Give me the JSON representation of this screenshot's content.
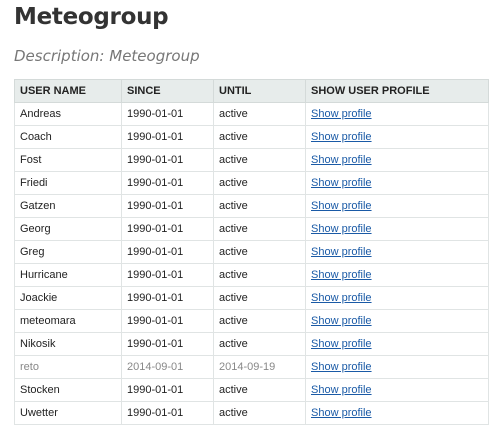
{
  "page": {
    "title": "Meteogroup",
    "description": "Description: Meteogroup"
  },
  "table": {
    "headers": [
      "USER NAME",
      "SINCE",
      "UNTIL",
      "SHOW USER PROFILE"
    ],
    "link_label": "Show profile",
    "rows": [
      {
        "name": "Andreas",
        "since": "1990-01-01",
        "until": "active",
        "link": "Show profile",
        "inactive": false
      },
      {
        "name": "Coach",
        "since": "1990-01-01",
        "until": "active",
        "link": "Show profile",
        "inactive": false
      },
      {
        "name": "Fost",
        "since": "1990-01-01",
        "until": "active",
        "link": "Show profile",
        "inactive": false
      },
      {
        "name": "Friedi",
        "since": "1990-01-01",
        "until": "active",
        "link": "Show profile",
        "inactive": false
      },
      {
        "name": "Gatzen",
        "since": "1990-01-01",
        "until": "active",
        "link": "Show profile",
        "inactive": false
      },
      {
        "name": "Georg",
        "since": "1990-01-01",
        "until": "active",
        "link": "Show profile",
        "inactive": false
      },
      {
        "name": "Greg",
        "since": "1990-01-01",
        "until": "active",
        "link": "Show profile",
        "inactive": false
      },
      {
        "name": "Hurricane",
        "since": "1990-01-01",
        "until": "active",
        "link": "Show profile",
        "inactive": false
      },
      {
        "name": "Joackie",
        "since": "1990-01-01",
        "until": "active",
        "link": "Show profile",
        "inactive": false
      },
      {
        "name": "meteomara",
        "since": "1990-01-01",
        "until": "active",
        "link": "Show profile",
        "inactive": false
      },
      {
        "name": "Nikosik",
        "since": "1990-01-01",
        "until": "active",
        "link": "Show profile",
        "inactive": false
      },
      {
        "name": "reto",
        "since": "2014-09-01",
        "until": "2014-09-19",
        "link": "Show profile",
        "inactive": true
      },
      {
        "name": "Stocken",
        "since": "1990-01-01",
        "until": "active",
        "link": "Show profile",
        "inactive": false
      },
      {
        "name": "Uwetter",
        "since": "1990-01-01",
        "until": "active",
        "link": "Show profile",
        "inactive": false
      }
    ]
  },
  "colors": {
    "link": "#1a5aa6",
    "header_bg": "#e7eceb",
    "inactive_text": "#888888"
  }
}
